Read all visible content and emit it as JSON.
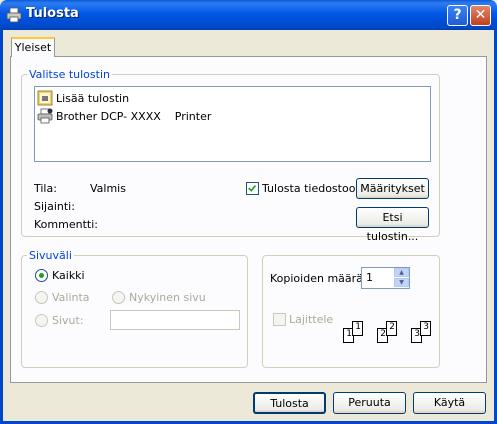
{
  "window": {
    "title": "Tulosta",
    "help_glyph": "?",
    "close_glyph": "✕"
  },
  "tabs": [
    {
      "label": "Yleiset"
    }
  ],
  "printer_group": {
    "legend": "Valitse tulostin",
    "printers": [
      {
        "label": "Lisää tulostin",
        "icon": "add-printer-icon"
      },
      {
        "label": "Brother DCP- XXXX    Printer",
        "icon": "printer-icon"
      }
    ],
    "status_label": "Tila:",
    "status_value": "Valmis",
    "location_label": "Sijainti:",
    "comment_label": "Kommentti:",
    "print_to_file_label": "Tulosta tiedostoon",
    "print_to_file_checked": true,
    "preferences_button": "Määritykset",
    "find_printer_button": "Etsi tulostin..."
  },
  "page_range": {
    "legend": "Sivuväli",
    "all_label": "Kaikki",
    "selection_label": "Valinta",
    "current_page_label": "Nykyinen sivu",
    "pages_label": "Sivut:",
    "pages_value": ""
  },
  "copies": {
    "count_label": "Kopioiden määrä:",
    "count_value": "1",
    "collate_label": "Lajittele",
    "collate_checked": false,
    "page_numbers": [
      "1",
      "1",
      "2",
      "2",
      "3",
      "3"
    ]
  },
  "footer": {
    "print_button": "Tulosta",
    "cancel_button": "Peruuta",
    "apply_button": "Käytä"
  },
  "colors": {
    "titlebar": "#0058e6",
    "group_legend": "#0046d5",
    "tab_highlight": "#ffc73c"
  }
}
